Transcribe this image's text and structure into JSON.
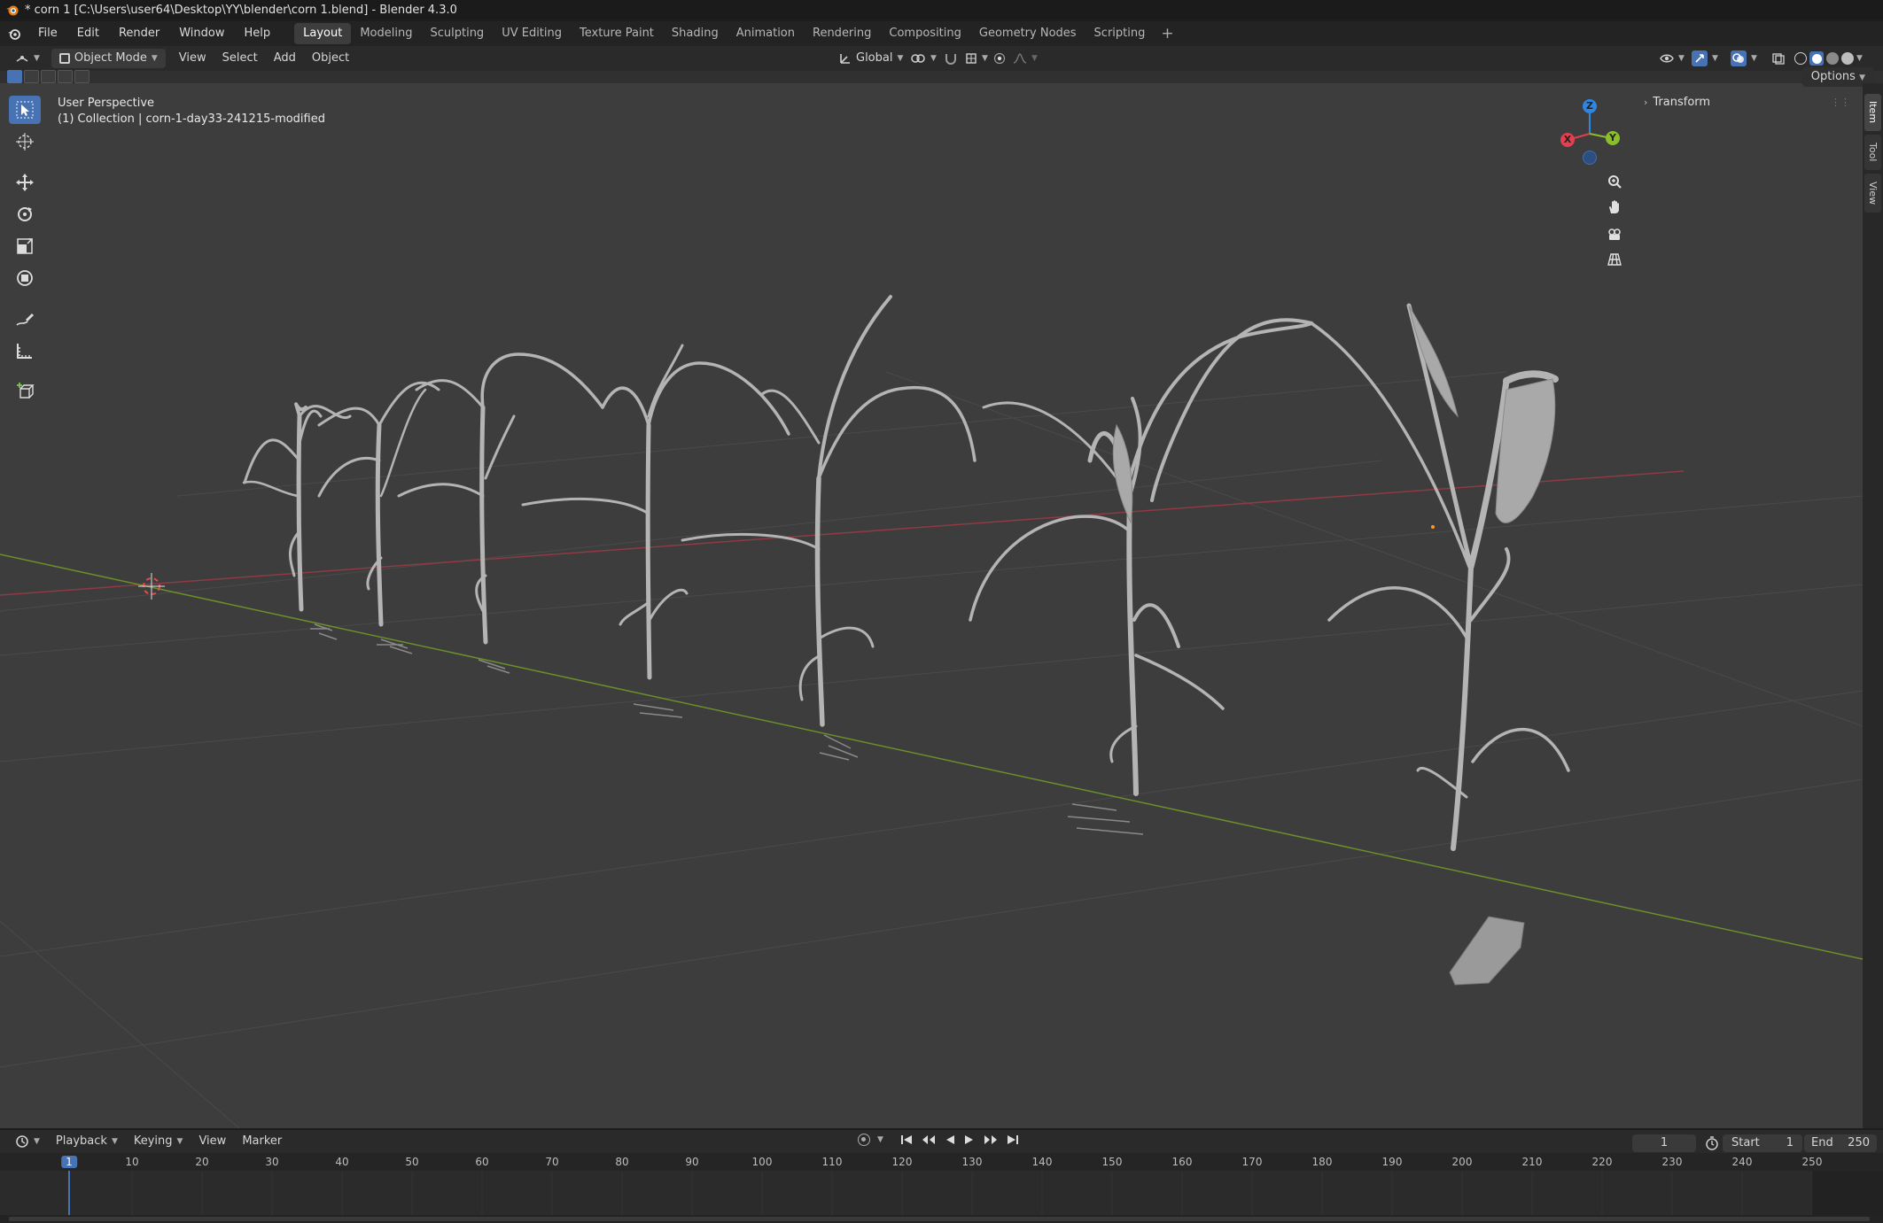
{
  "window": {
    "title": "* corn 1 [C:\\Users\\user64\\Desktop\\YY\\blender\\corn 1.blend] - Blender 4.3.0"
  },
  "menu": {
    "items": [
      "File",
      "Edit",
      "Render",
      "Window",
      "Help"
    ]
  },
  "workspaces": {
    "tabs": [
      "Layout",
      "Modeling",
      "Sculpting",
      "UV Editing",
      "Texture Paint",
      "Shading",
      "Animation",
      "Rendering",
      "Compositing",
      "Geometry Nodes",
      "Scripting"
    ],
    "active": "Layout",
    "add_label": "+"
  },
  "viewport_header": {
    "mode": "Object Mode",
    "menus": [
      "View",
      "Select",
      "Add",
      "Object"
    ],
    "orientation": "Global",
    "options_label": "Options"
  },
  "viewport": {
    "perspective": "User Perspective",
    "collection_info": "(1) Collection | corn-1-day33-241215-modified"
  },
  "gizmo": {
    "x_label": "X",
    "y_label": "Y",
    "z_label": "Z"
  },
  "n_panel": {
    "section": "Transform",
    "tabs": [
      "Item",
      "Tool",
      "View"
    ],
    "active_tab": "Item"
  },
  "timeline": {
    "menus": [
      "Playback",
      "Keying",
      "View",
      "Marker"
    ],
    "current_frame": "1",
    "start_label": "Start",
    "start_value": "1",
    "end_label": "End",
    "end_value": "250",
    "ruler_labels": [
      "1",
      "10",
      "20",
      "30",
      "40",
      "50",
      "60",
      "70",
      "80",
      "90",
      "100",
      "110",
      "120",
      "130",
      "140",
      "150",
      "160",
      "170",
      "180",
      "190",
      "200",
      "210",
      "220",
      "230",
      "240",
      "250"
    ]
  },
  "colors": {
    "accent": "#4772b3",
    "x_axis": "#e2404e",
    "y_axis": "#8bbf2a",
    "z_axis": "#2e86e0",
    "viewport_bg": "#3d3d3d"
  }
}
